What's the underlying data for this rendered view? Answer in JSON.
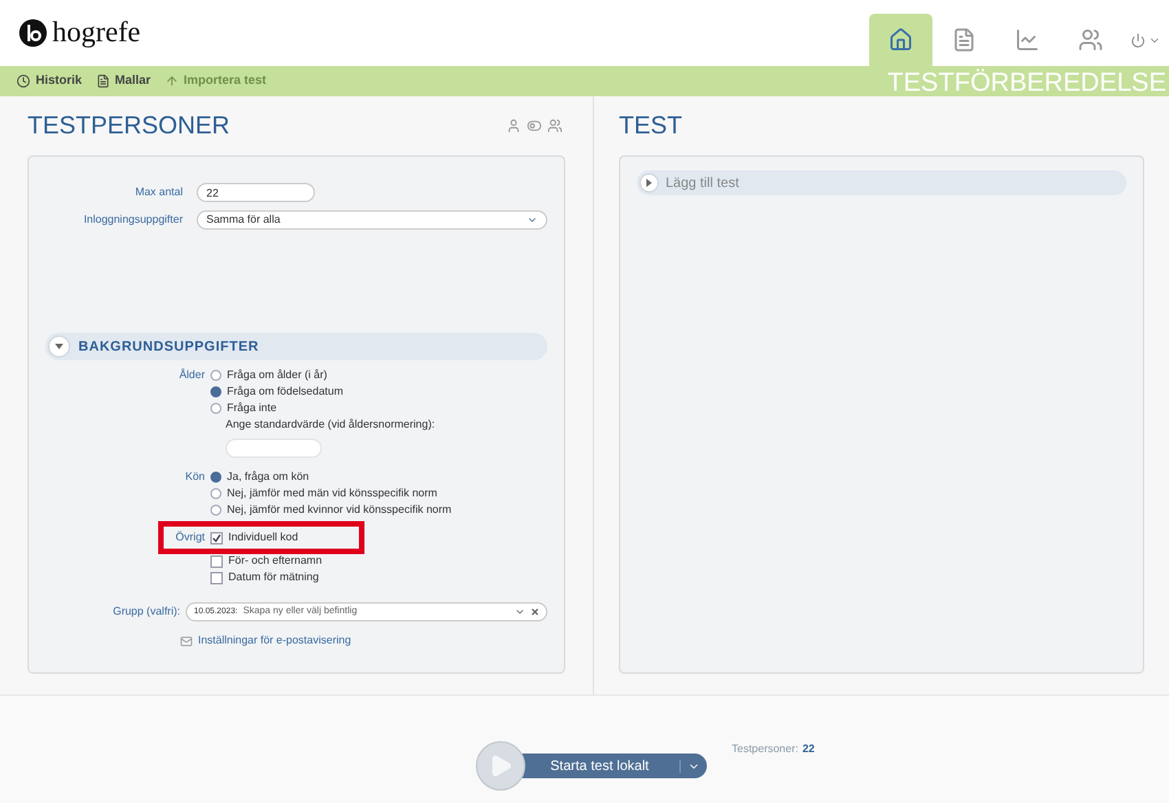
{
  "logo": {
    "text": "hogrefe"
  },
  "nav_tabs": [
    {
      "kind": "home",
      "selected": true
    },
    {
      "kind": "document",
      "selected": false
    },
    {
      "kind": "chart",
      "selected": false
    },
    {
      "kind": "people",
      "selected": false
    }
  ],
  "toolbar": {
    "items": [
      {
        "label": "Historik",
        "kind": "clock",
        "disabled": false
      },
      {
        "label": "Mallar",
        "kind": "document",
        "disabled": false
      },
      {
        "label": "Importera test",
        "kind": "arrow",
        "disabled": true
      }
    ],
    "section_title": "TESTFÖRBEREDELSE"
  },
  "testpersoner": {
    "title": "TESTPERSONER",
    "fields": [
      {
        "label": "Max antal",
        "value": "22",
        "kind": "input"
      },
      {
        "label": "Inloggningsuppgifter",
        "value": "Samma för alla",
        "kind": "select"
      }
    ],
    "background": {
      "title": "BAKGRUNDSUPPGIFTER",
      "expanded": true,
      "groups": [
        {
          "label": "Ålder",
          "kind": "radio",
          "highlighted": false,
          "options": [
            {
              "label": "Fråga om ålder (i år)",
              "selected": false
            },
            {
              "label": "Fråga om födelsedatum",
              "selected": true
            },
            {
              "label": "Fråga inte",
              "selected": false
            }
          ],
          "note": "Ange standardvärde (vid åldersnormering):"
        },
        {
          "label": "Kön",
          "kind": "radio",
          "highlighted": false,
          "options": [
            {
              "label": "Ja, fråga om kön",
              "selected": true
            },
            {
              "label": "Nej, jämför med män vid könsspecifik norm",
              "selected": false
            },
            {
              "label": "Nej, jämför med kvinnor vid könsspecifik norm",
              "selected": false
            }
          ]
        },
        {
          "label": "Övrigt",
          "kind": "checkbox",
          "highlighted": true,
          "options": [
            {
              "label": "Individuell kod",
              "checked": true
            },
            {
              "label": "För- och efternamn",
              "checked": false
            },
            {
              "label": "Datum för mätning",
              "checked": false
            }
          ]
        }
      ]
    },
    "group_field": {
      "label": "Grupp (valfri):",
      "date": "10.05.2023:",
      "placeholder": "Skapa ny eller välj befintlig"
    },
    "email_link": "Inställningar för e-postavisering"
  },
  "test": {
    "title": "TEST",
    "add_test": {
      "label": "Lägg till test",
      "expanded": false
    }
  },
  "footer": {
    "start_button": "Starta test lokalt",
    "count_label": "Testpersoner:",
    "count": "22"
  }
}
